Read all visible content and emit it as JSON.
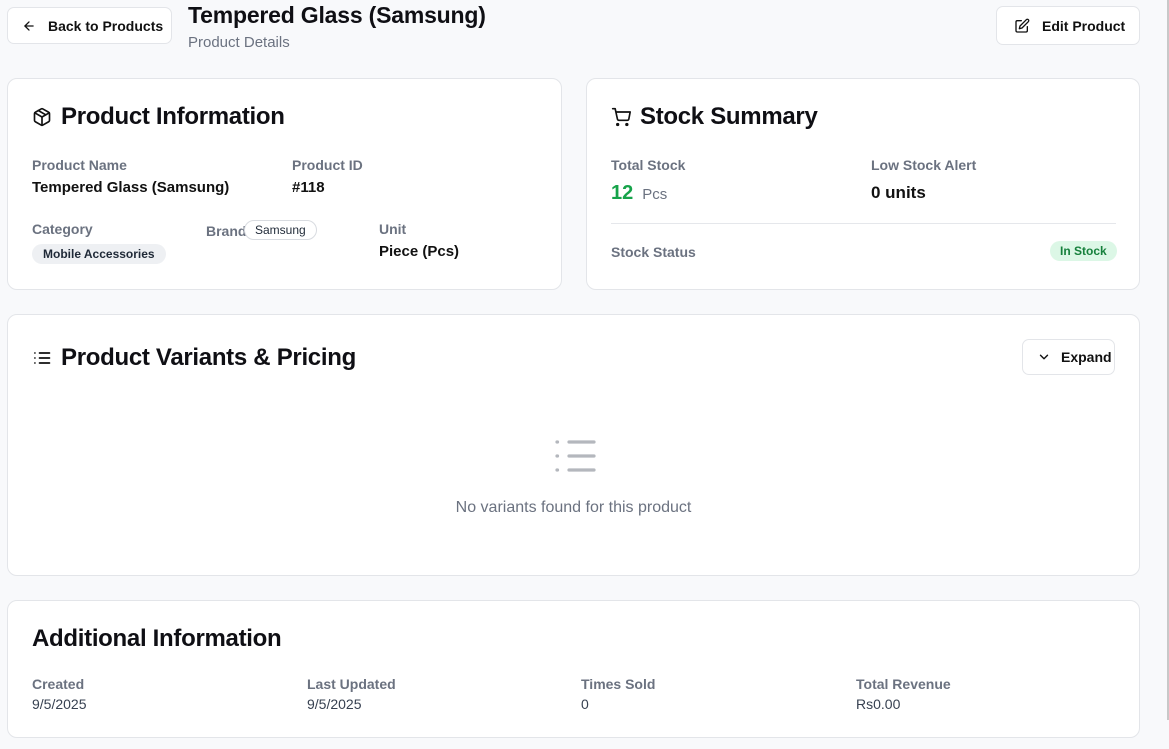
{
  "header": {
    "back_label": "Back to Products",
    "title": "Tempered Glass (Samsung)",
    "subtitle": "Product Details",
    "edit_label": "Edit Product"
  },
  "product_info": {
    "title": "Product Information",
    "name_label": "Product Name",
    "name_value": "Tempered Glass (Samsung)",
    "id_label": "Product ID",
    "id_value": "#118",
    "category_label": "Category",
    "category_value": "Mobile Accessories",
    "brand_label": "Brand",
    "brand_value": "Samsung",
    "unit_label": "Unit",
    "unit_value": "Piece (Pcs)"
  },
  "stock_summary": {
    "title": "Stock Summary",
    "total_label": "Total Stock",
    "total_value": "12",
    "total_unit": "Pcs",
    "low_label": "Low Stock Alert",
    "low_value": "0 units",
    "status_label": "Stock Status",
    "status_value": "In Stock",
    "colors": {
      "total_value": "#16a34a",
      "status_badge_bg": "#dcf7e6",
      "status_badge_text": "#16803c"
    }
  },
  "variants": {
    "title": "Product Variants & Pricing",
    "expand_label": "Expand",
    "empty_text": "No variants found for this product"
  },
  "additional": {
    "title": "Additional Information",
    "created_label": "Created",
    "created_value": "9/5/2025",
    "updated_label": "Last Updated",
    "updated_value": "9/5/2025",
    "sold_label": "Times Sold",
    "sold_value": "0",
    "revenue_label": "Total Revenue",
    "revenue_value": "Rs0.00"
  },
  "icons": {
    "back": "arrow-left-icon",
    "edit": "edit-icon",
    "product_info": "package-icon",
    "stock": "shopping-cart-icon",
    "variants": "list-icon",
    "expand": "chevron-down-icon",
    "empty": "list-icon"
  }
}
